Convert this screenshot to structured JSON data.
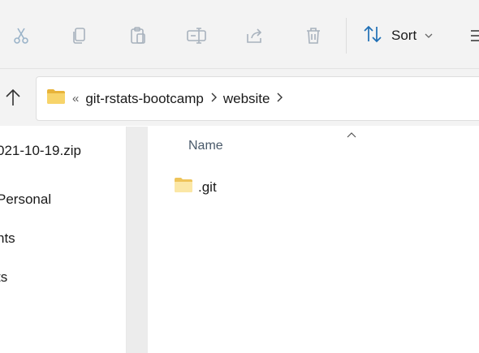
{
  "toolbar": {
    "buttons": [
      {
        "name": "cut-icon"
      },
      {
        "name": "copy-icon"
      },
      {
        "name": "paste-icon"
      },
      {
        "name": "rename-icon"
      },
      {
        "name": "share-icon"
      },
      {
        "name": "delete-icon"
      }
    ],
    "sort_label": "Sort"
  },
  "address": {
    "overflow": "«",
    "crumbs": [
      "git-rstats-bootcamp",
      "website"
    ]
  },
  "sidebar": {
    "items": [
      "021-10-19.zip",
      " Personal",
      "nts",
      "ts"
    ]
  },
  "main": {
    "column_name": "Name",
    "files": [
      {
        "label": ".git",
        "type": "folder"
      }
    ]
  },
  "colors": {
    "accent": "#1f6fb5",
    "folder": "#f7d46a",
    "icon_gray": "#a8b2bd"
  }
}
